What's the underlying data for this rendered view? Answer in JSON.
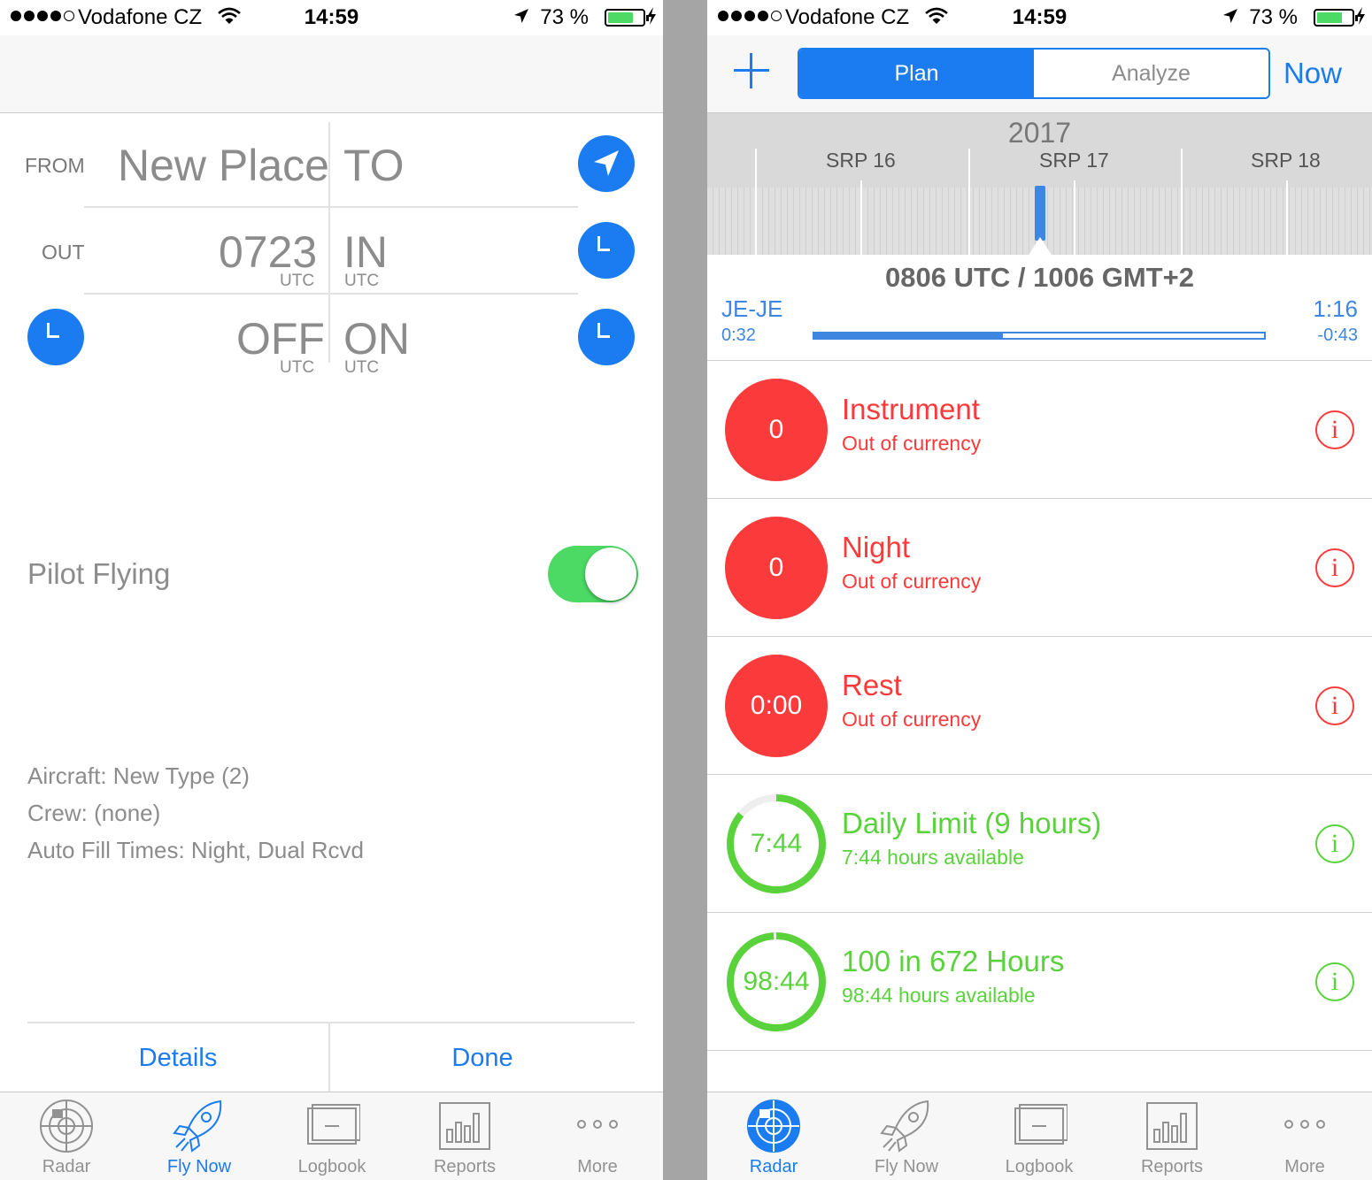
{
  "status_bar": {
    "carrier": "Vodafone CZ",
    "time": "14:59",
    "battery_text": "73 %",
    "battery_level": 0.73
  },
  "left": {
    "from_label": "FROM",
    "from_value": "New Place",
    "to_value": "TO",
    "out_label": "OUT",
    "out_value": "0723",
    "in_value": "IN",
    "off_value": "OFF",
    "on_value": "ON",
    "utc_label": "UTC",
    "pilot_flying_label": "Pilot Flying",
    "pilot_flying_on": true,
    "aircraft": "Aircraft: New Type (2)",
    "crew": "Crew: (none)",
    "auto_fill": "Auto Fill Times: Night, Dual Rcvd",
    "details_button": "Details",
    "done_button": "Done"
  },
  "right": {
    "segments": [
      "Plan",
      "Analyze"
    ],
    "selected_segment": "Plan",
    "now_button": "Now",
    "timeline": {
      "year": "2017",
      "labels": [
        "SRP 16",
        "SRP 17",
        "SRP 18"
      ]
    },
    "time_panel": {
      "title": "0806 UTC / 1006 GMT+2",
      "route": "JE-JE",
      "elapsed": "0:32",
      "total": "1:16",
      "remaining": "-0:43",
      "progress": 0.42
    },
    "currencies": [
      {
        "value": "0",
        "title": "Instrument",
        "subtitle": "Out of currency",
        "status": "red",
        "fraction": 1
      },
      {
        "value": "0",
        "title": "Night",
        "subtitle": "Out of currency",
        "status": "red",
        "fraction": 1
      },
      {
        "value": "0:00",
        "title": "Rest",
        "subtitle": "Out of currency",
        "status": "red",
        "fraction": 1
      },
      {
        "value": "7:44",
        "title": "Daily Limit (9 hours)",
        "subtitle": "7:44 hours available",
        "status": "green",
        "fraction": 0.86
      },
      {
        "value": "98:44",
        "title": "100 in 672 Hours",
        "subtitle": "98:44 hours available",
        "status": "green",
        "fraction": 0.99
      }
    ]
  },
  "tabs": [
    "Radar",
    "Fly Now",
    "Logbook",
    "Reports",
    "More"
  ],
  "left_active_tab": "Fly Now",
  "right_active_tab": "Radar",
  "colors": {
    "accent": "#1a7cf0",
    "red": "#fb3b3b",
    "green": "#5ad23c",
    "toggle_on": "#4cd964"
  }
}
